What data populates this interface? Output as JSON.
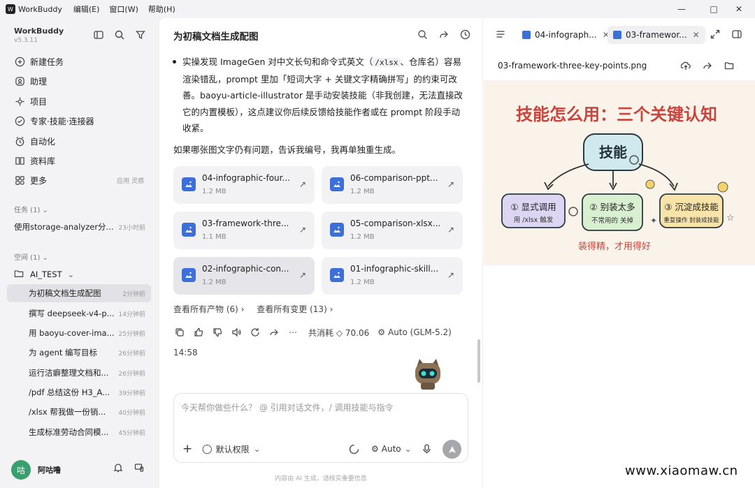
{
  "app": {
    "name": "WorkBuddy",
    "version": "v5.3.11",
    "menus": [
      "编辑(E)",
      "窗口(W)",
      "帮助(H)"
    ]
  },
  "sidebar": {
    "nav": [
      {
        "label": "新建任务",
        "icon": "plus-circle-icon"
      },
      {
        "label": "助理",
        "icon": "assistant-icon"
      },
      {
        "label": "项目",
        "icon": "project-icon"
      },
      {
        "label": "专家·技能·连接器",
        "icon": "experts-icon"
      },
      {
        "label": "自动化",
        "icon": "clock-icon"
      },
      {
        "label": "资料库",
        "icon": "book-icon"
      },
      {
        "label": "更多",
        "icon": "grid-icon",
        "extra": "应用 灵感"
      }
    ],
    "tasks_section": "任务 (1)",
    "tasks": [
      {
        "title": "使用storage-analyzer分...",
        "time": "23小时前"
      }
    ],
    "space_section": "空间 (1)",
    "project": "AI_TEST",
    "threads": [
      {
        "title": "为初稿文档生成配图",
        "time": "2分钟前",
        "active": true
      },
      {
        "title": "撰写 deepseek-v4-p...",
        "time": "14分钟前"
      },
      {
        "title": "用 baoyu-cover-ima...",
        "time": "25分钟前"
      },
      {
        "title": "为 agent 编写目标",
        "time": "26分钟前"
      },
      {
        "title": "运行洁癖整理文档和...",
        "time": "26分钟前"
      },
      {
        "title": "/pdf 总结这份 H3_A...",
        "time": "39分钟前"
      },
      {
        "title": "/xlsx 帮我做一份销...",
        "time": "40分钟前"
      },
      {
        "title": "生成标准劳动合同模...",
        "time": "45分钟前"
      }
    ],
    "user": {
      "name": "阿咕噜",
      "avatar_glyph": "咕"
    }
  },
  "chat": {
    "title": "为初稿文档生成配图",
    "bullet": {
      "p1": "实操发现 ImageGen 对中文长句和命令式英文（",
      "code1": "/xlsx",
      "p2": "、仓库名）容易渲染错乱，prompt 里加「短词大字 + 关键文字精确拼写」的约束可改善。baoyu-article-illustrator 是手动安装技能（非我创建，无法直接改它的内置模板），这点建议你后续反馈给技能作者或在 prompt 阶段手动收紧。"
    },
    "paragraph": "如果哪张图文字仍有问题，告诉我编号，我再单独重生成。",
    "files": [
      {
        "name": "04-infographic-four...",
        "size": "1.2 MB"
      },
      {
        "name": "06-comparison-ppt...",
        "size": "1.2 MB"
      },
      {
        "name": "03-framework-thre...",
        "size": "1.1 MB"
      },
      {
        "name": "05-comparison-xlsx...",
        "size": "1.2 MB"
      },
      {
        "name": "02-infographic-con...",
        "size": "1.2 MB"
      },
      {
        "name": "01-infographic-skill...",
        "size": "1.2 MB"
      }
    ],
    "view_outputs": "查看所有产物 (6)",
    "view_changes": "查看所有变更 (13)",
    "usage": "共消耗 ◇ 70.06",
    "model_label": "Auto (GLM-5.2)",
    "timestamp": "14:58",
    "input_placeholder": "今天帮你做些什么？ @ 引用对话文件，/ 调用技能与指令",
    "permission": "默认权限",
    "mode": "Auto",
    "disclaimer": "内容由 AI 生成，请核实重要信息"
  },
  "preview": {
    "tabs": [
      {
        "label": "04-infograph..."
      },
      {
        "label": "03-framewor...",
        "active": true
      }
    ],
    "filename": "03-framework-three-key-points.png",
    "image": {
      "title": "技能怎么用：三个关键认知",
      "center": "技能",
      "boxes": [
        {
          "title": "① 显式调用",
          "sub": "用 /xlsx 触发"
        },
        {
          "title": "② 别装太多",
          "sub": "不常用的 关掉"
        },
        {
          "title": "③ 沉淀成技能",
          "sub": "重复操作 封装成技能"
        }
      ],
      "footer": "装得精，才用得好"
    }
  },
  "watermark": "www.xiaomaw.cn",
  "colors": {
    "accent": "#3d6fd9",
    "img_title": "#c8443c",
    "sidebar_bg": "#f3f3f5"
  }
}
